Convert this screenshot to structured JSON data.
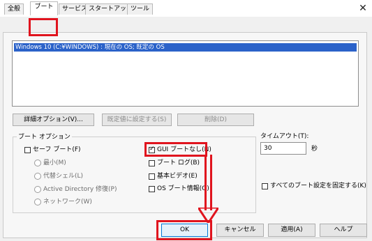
{
  "tabs": [
    "全般",
    "ブート",
    "サービス",
    "スタートアップ",
    "ツール"
  ],
  "os_entry": "Windows 10 (C:¥WINDOWS) : 現在の OS; 既定の OS",
  "buttons": {
    "advanced": "詳細オプション(V)...",
    "set_default": "既定値に設定する(S)",
    "delete": "削除(D)"
  },
  "boot_options": {
    "title": "ブート オプション",
    "safe_boot": "セーフ ブート(F)",
    "minimal": "最小(M)",
    "alternate_shell": "代替シェル(L)",
    "ad_repair": "Active Directory 修復(P)",
    "network": "ネットワーク(W)",
    "no_gui_boot": "GUI ブートなし(N)",
    "boot_log": "ブート ログ(B)",
    "base_video": "基本ビデオ(E)",
    "os_boot_info": "OS ブート情報(O)"
  },
  "timeout": {
    "label": "タイムアウト(T):",
    "value": "30",
    "unit": "秒"
  },
  "make_permanent": "すべてのブート設定を固定する(K)",
  "footer": {
    "ok": "OK",
    "cancel": "キャンセル",
    "apply": "適用(A)",
    "help": "ヘルプ"
  },
  "colors": {
    "highlight": "#e0141e",
    "selection": "#2b62c9"
  }
}
